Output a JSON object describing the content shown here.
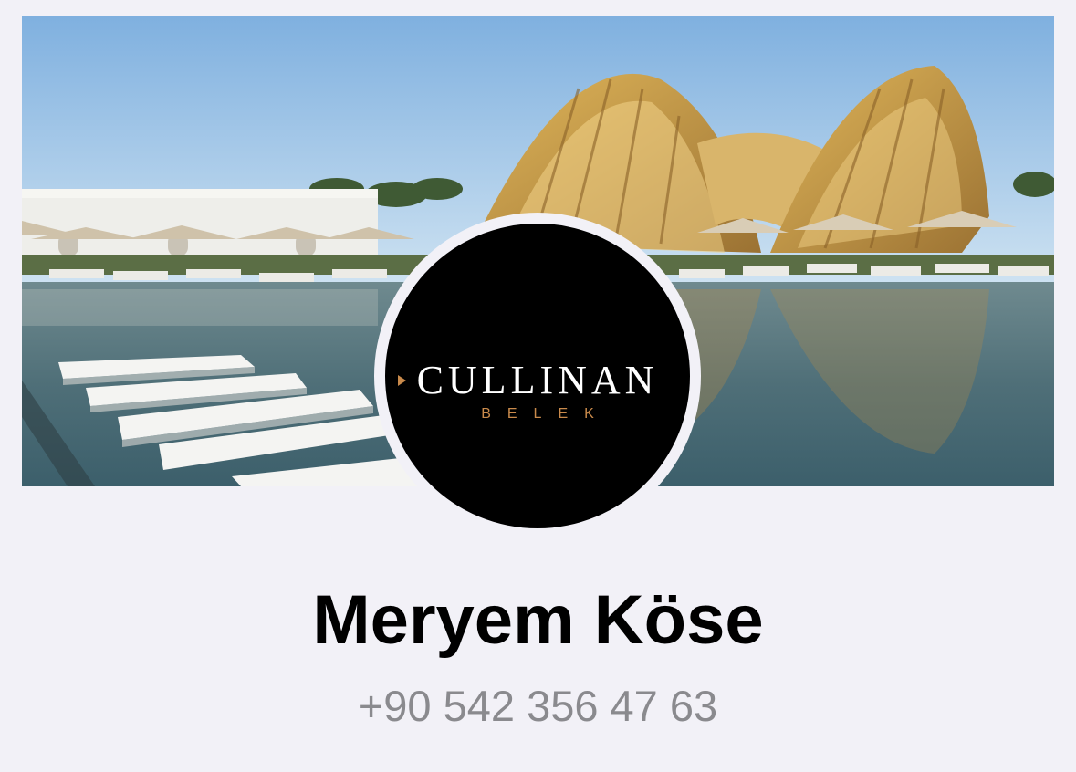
{
  "contact": {
    "name": "Meryem Köse",
    "phone": "+90 542 356 47 63"
  },
  "avatar": {
    "logo_text": "CULLINAN",
    "logo_subtext": "BELEK",
    "logo_color": "#c98a4b",
    "background_color": "#000000"
  },
  "cover_photo": {
    "icon": "resort-pool-photo"
  },
  "colors": {
    "page_background": "#f2f1f7",
    "name": "#000000",
    "phone": "#8a8a8e"
  }
}
